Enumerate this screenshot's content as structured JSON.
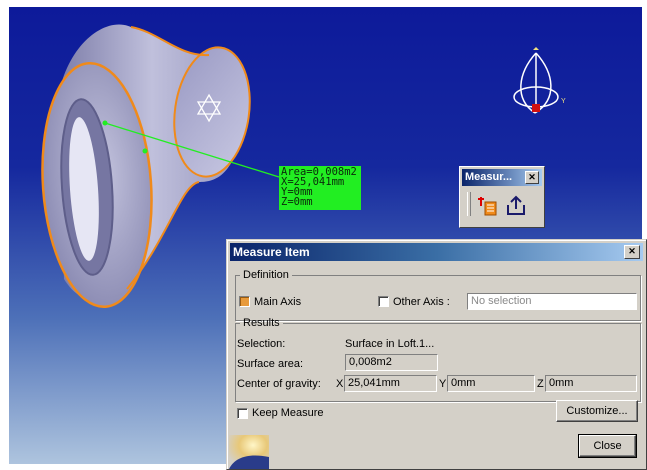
{
  "label3d": {
    "area": "Area=0,008m2",
    "x": "X=25,041mm",
    "y": "Y=0mm",
    "z": "Z=0mm"
  },
  "toolbar": {
    "title": "Measur..."
  },
  "dialog": {
    "title": "Measure Item",
    "definition": {
      "legend": "Definition",
      "main_axis_label": "Main Axis",
      "main_axis_checked": true,
      "other_axis_label": "Other Axis :",
      "other_axis_checked": false,
      "other_axis_value": "No selection"
    },
    "results": {
      "legend": "Results",
      "selection_label": "Selection:",
      "selection_value": "Surface in Loft.1...",
      "surface_area_label": "Surface area:",
      "surface_area_value": "0,008m2",
      "cog_label": "Center of gravity:",
      "x_label": "X",
      "x_value": "25,041mm",
      "y_label": "Y",
      "y_value": "0mm",
      "z_label": "Z",
      "z_value": "0mm"
    },
    "keep_measure_label": "Keep Measure",
    "keep_measure_checked": false,
    "customize_label": "Customize...",
    "close_label": "Close"
  },
  "colors": {
    "background_top": "#0d1a9a",
    "background_bottom": "#aec4de",
    "highlight_edge": "#f08a1a",
    "measure_label_bg": "#22ee22",
    "titlebar": "#0a246a"
  },
  "icons": [
    "star-of-david-icon",
    "compass-icon",
    "measure-inertia-icon",
    "export-icon",
    "close-icon",
    "catia-logo-icon"
  ]
}
